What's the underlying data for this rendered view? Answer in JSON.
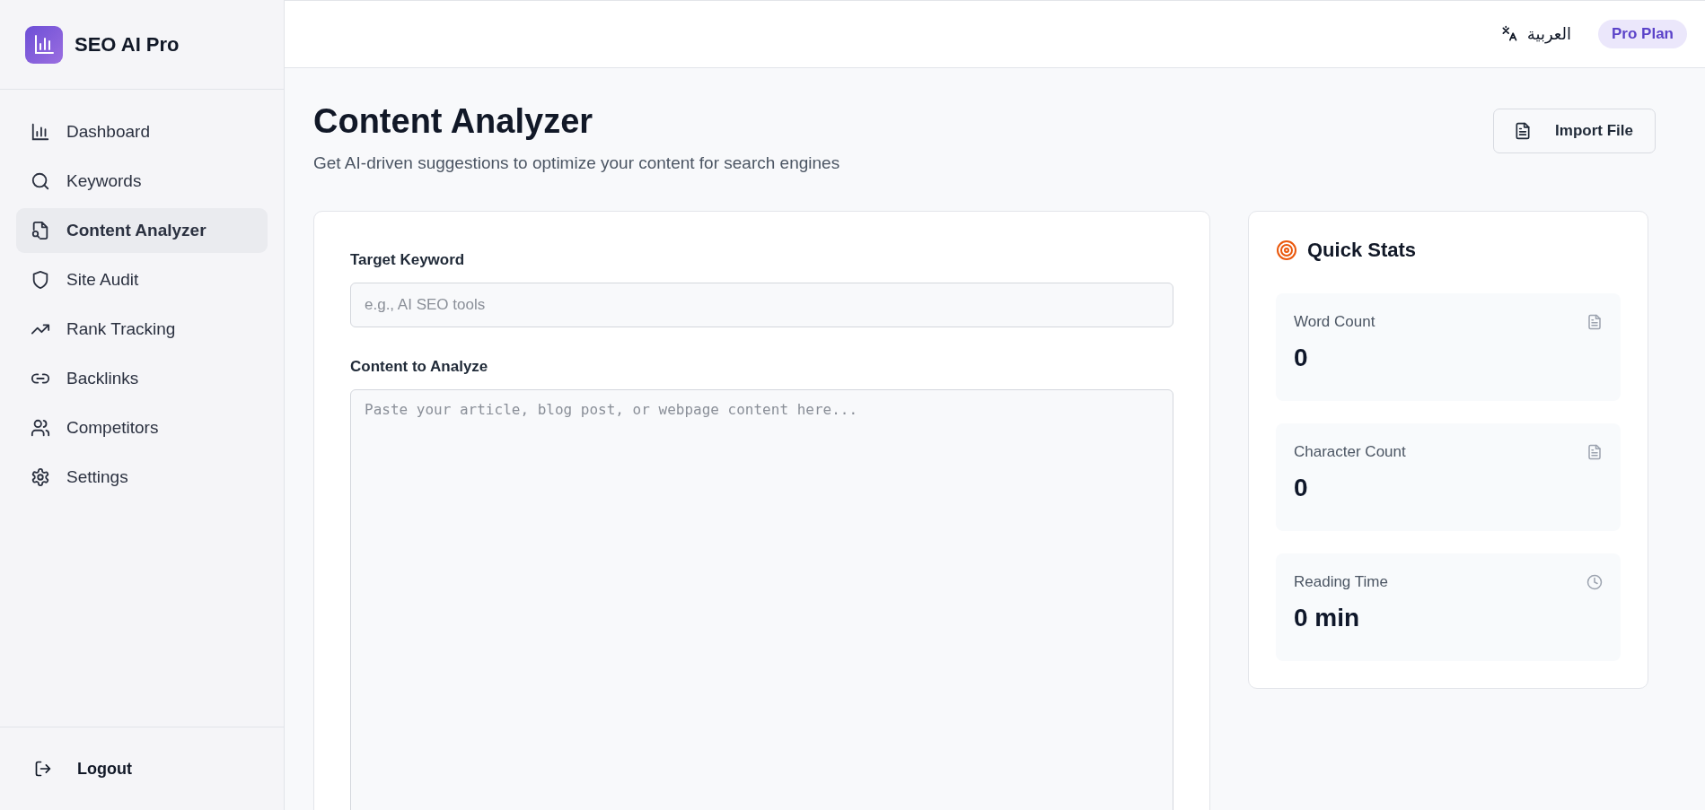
{
  "brand": {
    "name": "SEO AI Pro"
  },
  "sidebar": {
    "items": [
      {
        "label": "Dashboard",
        "selected": false
      },
      {
        "label": "Keywords",
        "selected": false
      },
      {
        "label": "Content Analyzer",
        "selected": true
      },
      {
        "label": "Site Audit",
        "selected": false
      },
      {
        "label": "Rank Tracking",
        "selected": false
      },
      {
        "label": "Backlinks",
        "selected": false
      },
      {
        "label": "Competitors",
        "selected": false
      },
      {
        "label": "Settings",
        "selected": false
      }
    ],
    "logout": "Logout"
  },
  "header": {
    "language": "العربية",
    "plan": "Pro Plan"
  },
  "page": {
    "title": "Content Analyzer",
    "subtitle": "Get AI-driven suggestions to optimize your content for search engines",
    "import_button": "Import File"
  },
  "form": {
    "keyword_label": "Target Keyword",
    "keyword_placeholder": "e.g., AI SEO tools",
    "content_label": "Content to Analyze",
    "content_placeholder": "Paste your article, blog post, or webpage content here..."
  },
  "quick_stats": {
    "title": "Quick Stats",
    "stats": [
      {
        "label": "Word Count",
        "value": "0"
      },
      {
        "label": "Character Count",
        "value": "0"
      },
      {
        "label": "Reading Time",
        "value": "0 min"
      }
    ]
  }
}
